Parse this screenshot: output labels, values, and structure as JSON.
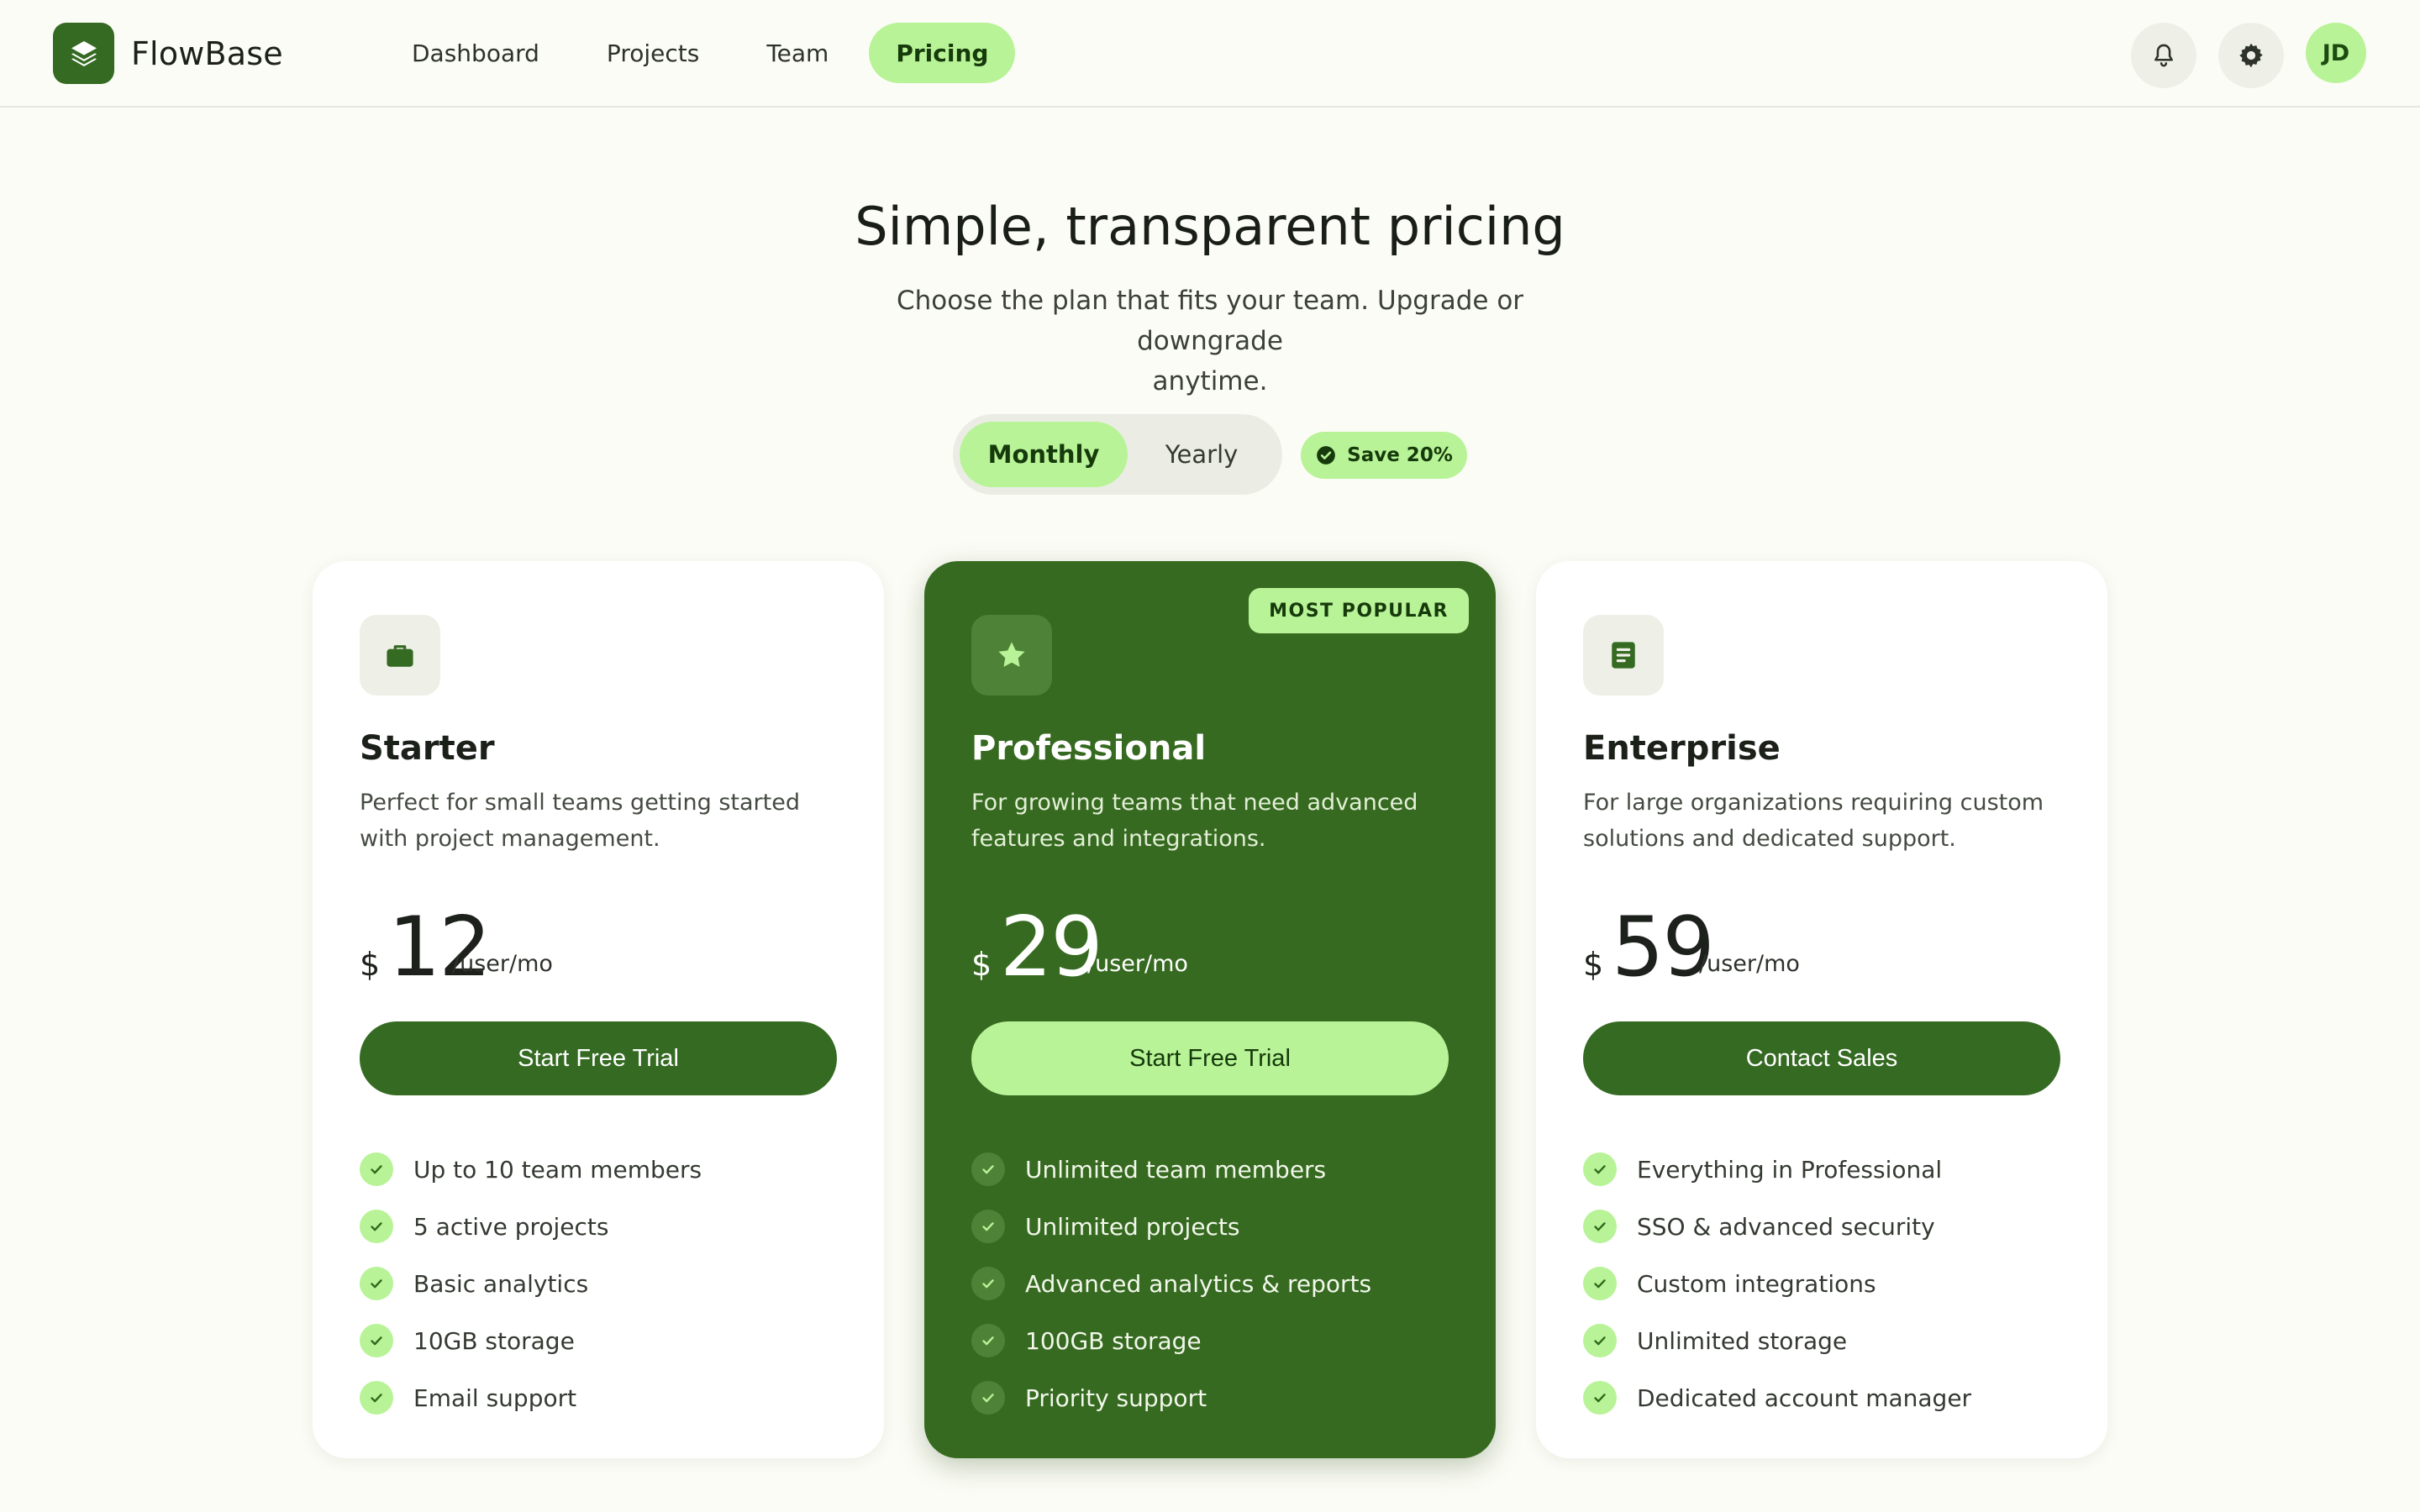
{
  "header": {
    "brand": "FlowBase",
    "nav": [
      {
        "label": "Dashboard",
        "active": false
      },
      {
        "label": "Projects",
        "active": false
      },
      {
        "label": "Team",
        "active": false
      },
      {
        "label": "Pricing",
        "active": true
      }
    ],
    "icons": [
      "bell-icon",
      "gear-icon"
    ],
    "avatar_initials": "JD"
  },
  "hero": {
    "title": "Simple, transparent pricing",
    "subtitle_line1": "Choose the plan that fits your team. Upgrade or downgrade",
    "subtitle_line2": "anytime."
  },
  "billing": {
    "options": [
      "Monthly",
      "Yearly"
    ],
    "selected": "Monthly",
    "save_badge": "Save 20%"
  },
  "plans": [
    {
      "name": "Starter",
      "icon": "briefcase-icon",
      "description": "Perfect for small teams getting started with project management.",
      "currency": "$",
      "price": "12",
      "period": "/user/mo",
      "cta": "Start Free Trial",
      "features": [
        "Up to 10 team members",
        "5 active projects",
        "Basic analytics",
        "10GB storage",
        "Email support"
      ]
    },
    {
      "name": "Professional",
      "icon": "star-icon",
      "badge": "MOST POPULAR",
      "description": "For growing teams that need advanced features and integrations.",
      "currency": "$",
      "price": "29",
      "period": "/user/mo",
      "cta": "Start Free Trial",
      "features": [
        "Unlimited team members",
        "Unlimited projects",
        "Advanced analytics & reports",
        "100GB storage",
        "Priority support"
      ]
    },
    {
      "name": "Enterprise",
      "icon": "document-icon",
      "description": "For large organizations requiring custom solutions and dedicated support.",
      "currency": "$",
      "price": "59",
      "period": "/user/mo",
      "cta": "Contact Sales",
      "features": [
        "Everything in Professional",
        "SSO & advanced security",
        "Custom integrations",
        "Unlimited storage",
        "Dedicated account manager"
      ]
    }
  ],
  "colors": {
    "primary": "#356a22",
    "accent": "#b8f397",
    "background": "#fcfcf6"
  }
}
